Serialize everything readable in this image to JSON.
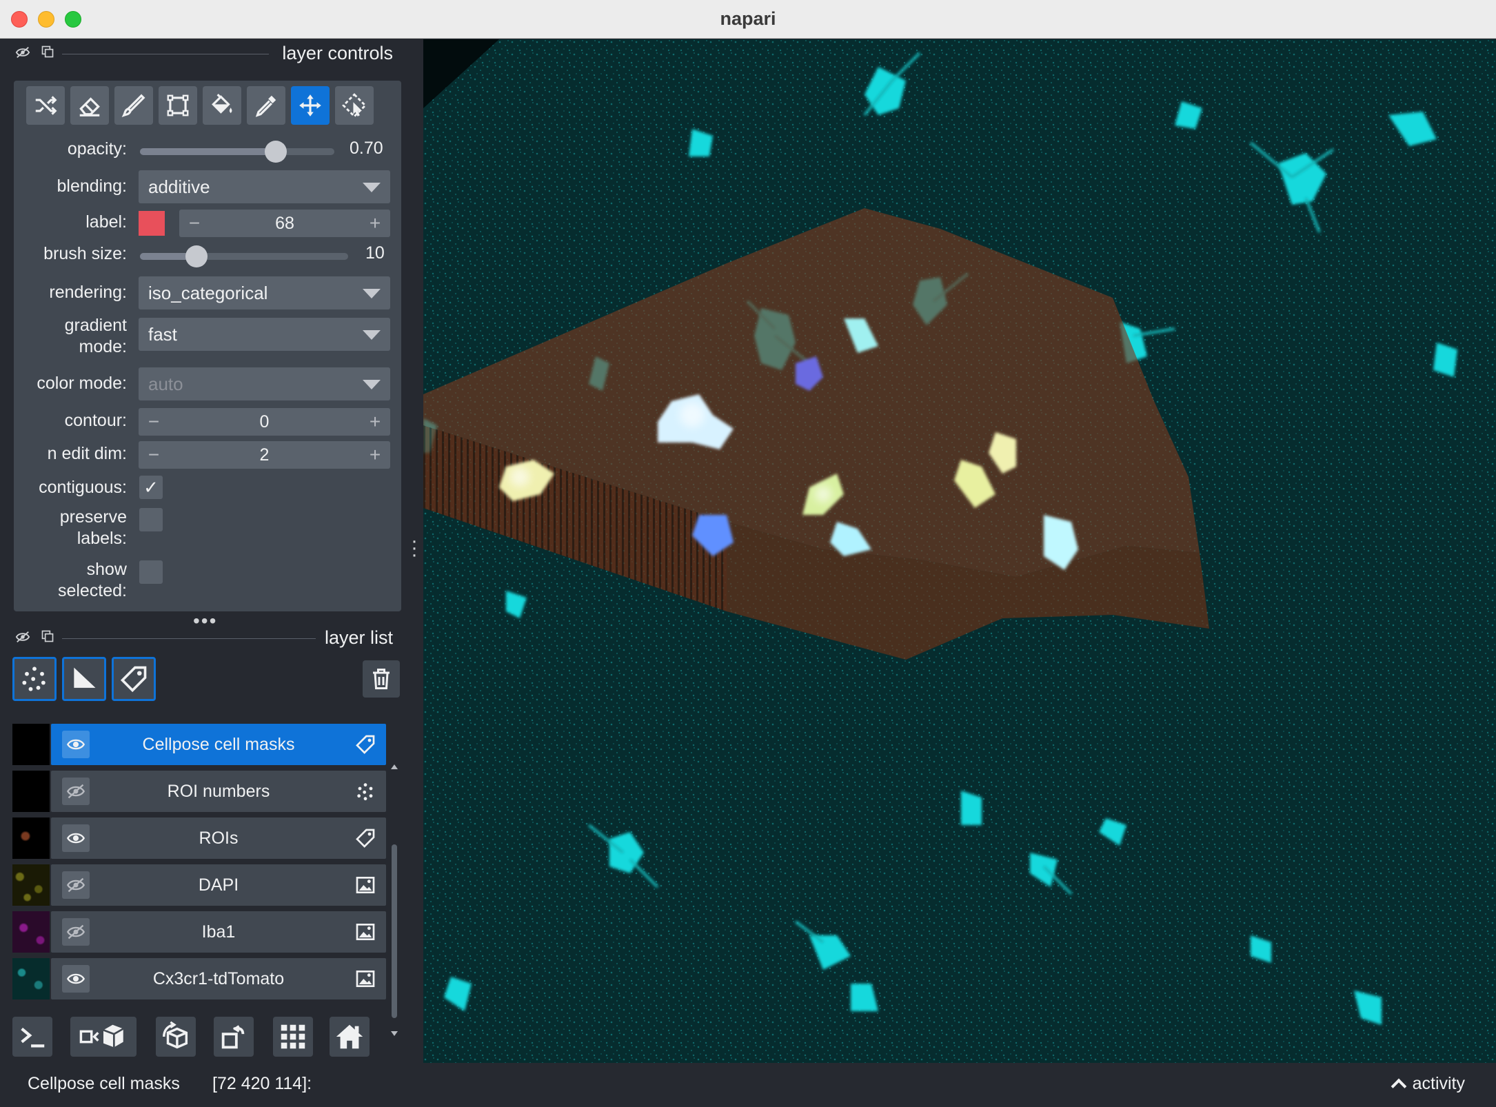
{
  "window": {
    "title": "napari"
  },
  "layer_controls": {
    "title": "layer controls",
    "tools": [
      "shuffle-colors",
      "eraser",
      "paint-brush",
      "polygon",
      "fill-bucket",
      "color-picker",
      "pan-zoom",
      "transform"
    ],
    "active_tool": "pan-zoom",
    "opacity": {
      "label": "opacity:",
      "value": "0.70",
      "fraction": 0.7
    },
    "blending": {
      "label": "blending:",
      "value": "additive"
    },
    "label": {
      "label": "label:",
      "value": "68",
      "color": "#e8505b"
    },
    "brush_size": {
      "label": "brush size:",
      "value": "10",
      "fraction": 0.27
    },
    "rendering": {
      "label": "rendering:",
      "value": "iso_categorical"
    },
    "gradient_mode": {
      "label_line1": "gradient",
      "label_line2": "mode:",
      "value": "fast"
    },
    "color_mode": {
      "label": "color mode:",
      "value": "auto"
    },
    "contour": {
      "label": "contour:",
      "value": "0"
    },
    "n_edit_dim": {
      "label": "n edit dim:",
      "value": "2"
    },
    "contiguous": {
      "label": "contiguous:",
      "checked": true,
      "mark": "✓"
    },
    "preserve_labels": {
      "label_line1": "preserve",
      "label_line2": "labels:",
      "checked": false
    },
    "show_selected": {
      "label_line1": "show",
      "label_line2": "selected:",
      "checked": false
    }
  },
  "layer_list": {
    "title": "layer list",
    "new_layer_buttons": [
      "new-points-layer",
      "new-shapes-layer",
      "new-labels-layer"
    ],
    "layers": [
      {
        "name": "Cellpose cell masks",
        "visible": true,
        "type": "labels",
        "selected": true
      },
      {
        "name": "ROI numbers",
        "visible": false,
        "type": "points",
        "selected": false
      },
      {
        "name": "ROIs",
        "visible": true,
        "type": "labels",
        "selected": false
      },
      {
        "name": "DAPI",
        "visible": false,
        "type": "image",
        "selected": false
      },
      {
        "name": "Iba1",
        "visible": false,
        "type": "image",
        "selected": false
      },
      {
        "name": "Cx3cr1-tdTomato",
        "visible": true,
        "type": "image",
        "selected": false
      }
    ]
  },
  "bottom_toolbar": [
    "console",
    "ndisplay-toggle",
    "roll-dimensions",
    "transpose",
    "grid-mode",
    "reset-view"
  ],
  "status": {
    "layer": "Cellpose cell masks",
    "coords": "[72 420 114]:",
    "activity": "activity"
  },
  "colors": {
    "accent": "#0f73d8",
    "panel": "#414851",
    "background": "#262930",
    "cyan": "#19e6e6",
    "roi": "#8a4a2a"
  }
}
